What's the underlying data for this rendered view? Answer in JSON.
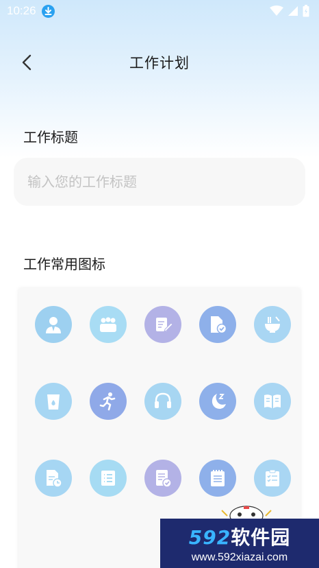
{
  "status_bar": {
    "time": "10:26"
  },
  "nav": {
    "title": "工作计划"
  },
  "form": {
    "title_label": "工作标题",
    "title_placeholder": "输入您的工作标题",
    "icons_label": "工作常用图标"
  },
  "icons": [
    {
      "name": "person",
      "color": "#9dd0f0"
    },
    {
      "name": "group",
      "color": "#a8dcf4"
    },
    {
      "name": "edit",
      "color": "#b3b2e6"
    },
    {
      "name": "document-check",
      "color": "#8eb0ea"
    },
    {
      "name": "noodle-bowl",
      "color": "#a9d6f3"
    },
    {
      "name": "water-cup",
      "color": "#a6d6f3"
    },
    {
      "name": "running",
      "color": "#8fa9e8"
    },
    {
      "name": "headphones",
      "color": "#a7d6f2"
    },
    {
      "name": "sleep-moon",
      "color": "#8eb0ea"
    },
    {
      "name": "open-book",
      "color": "#a9d6f3"
    },
    {
      "name": "schedule-document",
      "color": "#a6d6f3"
    },
    {
      "name": "list",
      "color": "#a6dbf3"
    },
    {
      "name": "approved-document",
      "color": "#b3b2e6"
    },
    {
      "name": "notepad",
      "color": "#8eb0ea"
    },
    {
      "name": "checklist",
      "color": "#a9d6f3"
    }
  ],
  "watermark": {
    "number": "592",
    "brand": "软件园",
    "url": "www.592xiazai.com"
  }
}
